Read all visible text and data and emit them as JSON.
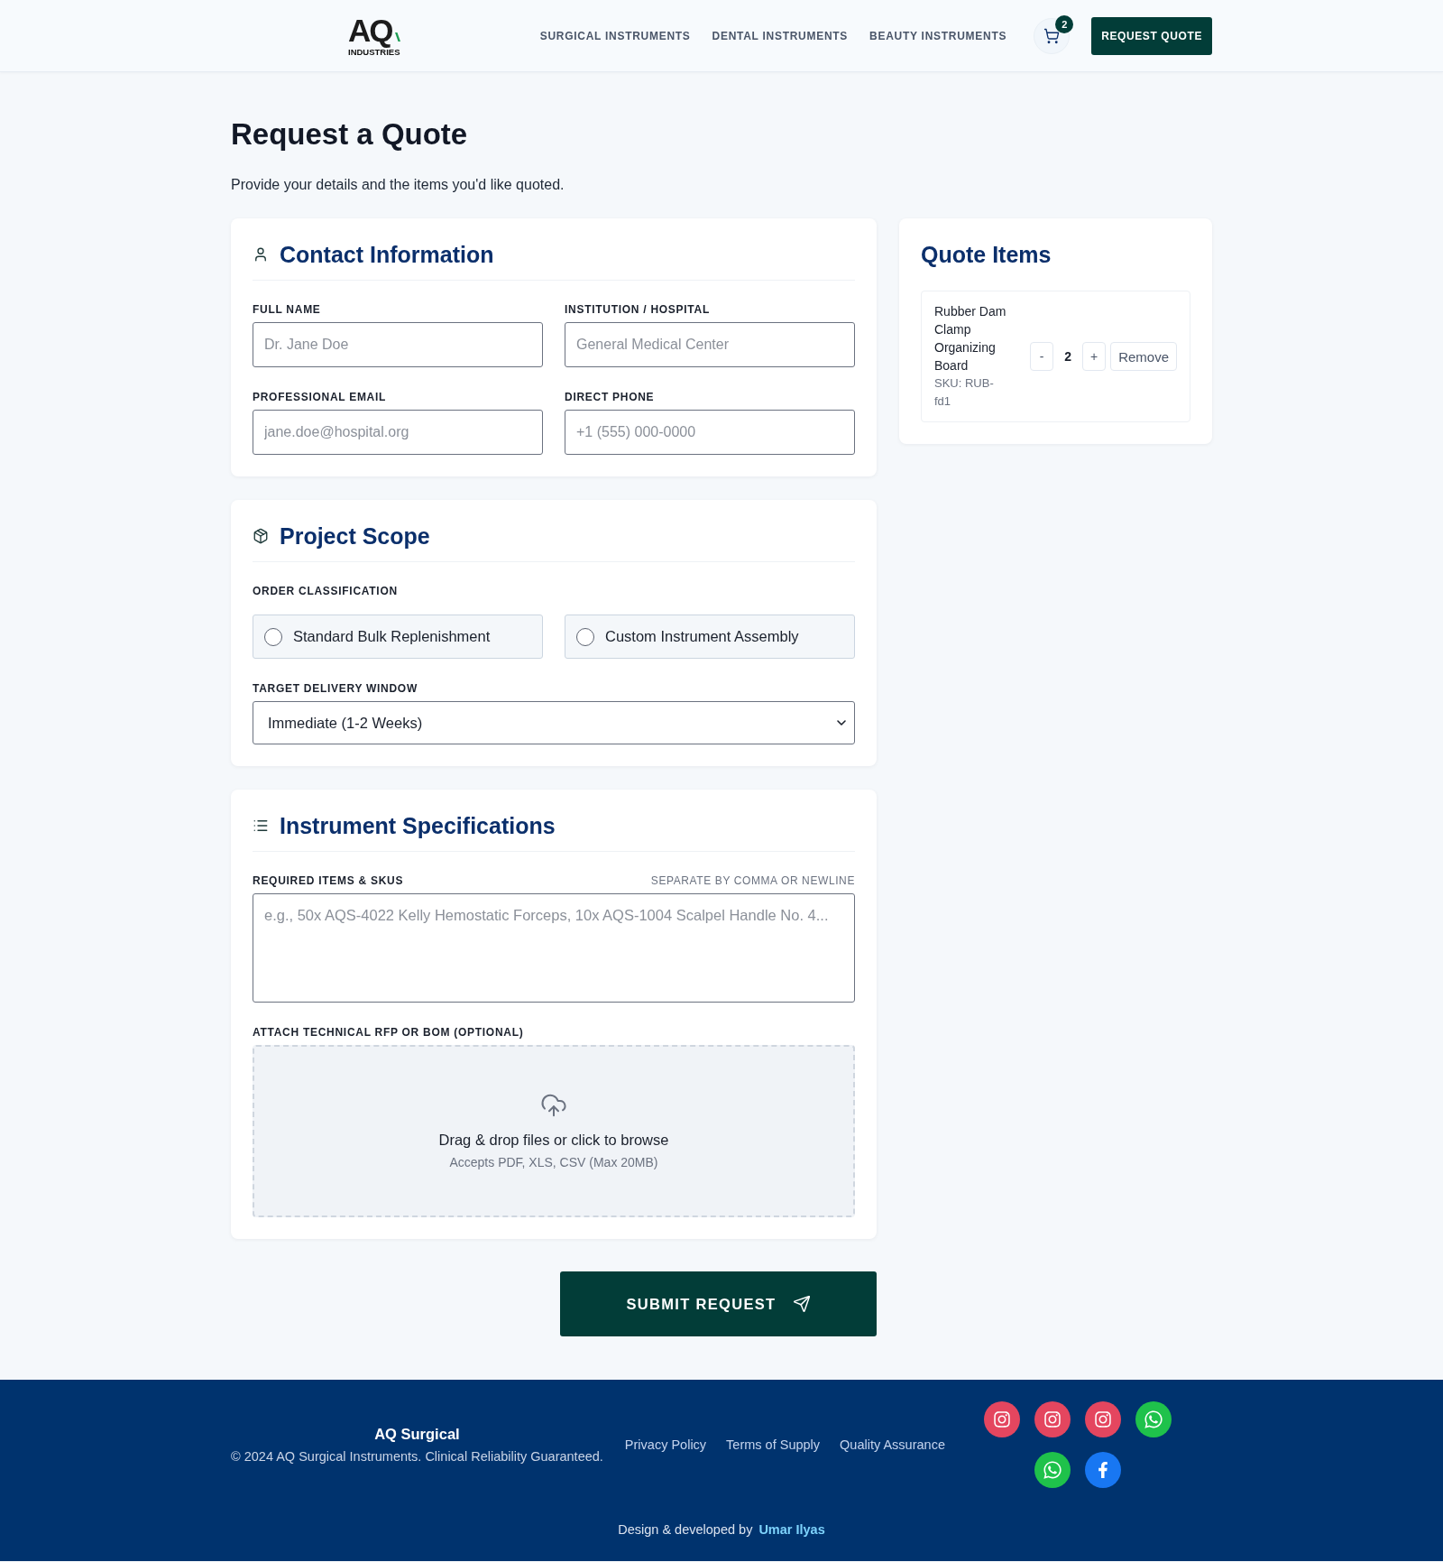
{
  "header": {
    "logo": {
      "mark": "AQ",
      "subtitle": "INDUSTRIES"
    },
    "nav": [
      "SURGICAL INSTRUMENTS",
      "DENTAL INSTRUMENTS",
      "BEAUTY INSTRUMENTS"
    ],
    "cart_count": "2",
    "cta": "REQUEST QUOTE"
  },
  "intro": {
    "title": "Request a Quote",
    "subtitle": "Provide your details and the items you'd like quoted."
  },
  "contact_information": {
    "title": "Contact Information",
    "fields": [
      {
        "label": "FULL NAME",
        "placeholder": "Dr. Jane Doe"
      },
      {
        "label": "INSTITUTION / HOSPITAL",
        "placeholder": "General Medical Center"
      },
      {
        "label": "PROFESSIONAL EMAIL",
        "placeholder": "jane.doe@hospital.org"
      },
      {
        "label": "DIRECT PHONE",
        "placeholder": "+1 (555) 000-0000"
      }
    ]
  },
  "project_scope": {
    "title": "Project Scope",
    "order_classification": {
      "label": "ORDER CLASSIFICATION",
      "options": [
        {
          "label": "Standard Bulk Replenishment",
          "selected": false
        },
        {
          "label": "Custom Instrument Assembly",
          "selected": false
        }
      ]
    },
    "delivery_window": {
      "label": "TARGET DELIVERY WINDOW",
      "value": "Immediate (1-2 Weeks)"
    }
  },
  "instrument_specifications": {
    "title": "Instrument Specifications",
    "required_items": {
      "label": "REQUIRED ITEMS & SKUS",
      "hint": "SEPARATE BY COMMA OR NEWLINE",
      "placeholder": "e.g., 50x AQS-4022 Kelly Hemostatic Forceps, 10x AQS-1004 Scalpel Handle No. 4..."
    },
    "attachment": {
      "label": "ATTACH TECHNICAL RFP OR BOM (OPTIONAL)",
      "prompt": "Drag & drop files or click to browse",
      "note": "Accepts PDF, XLS, CSV (Max 20MB)"
    }
  },
  "submit_button": "SUBMIT REQUEST",
  "quote_items": {
    "title": "Quote Items",
    "items": [
      {
        "name": "Rubber Dam Clamp Organizing Board",
        "sku": "SKU: RUB-fd1",
        "decrement": "-",
        "quantity": "2",
        "increment": "+",
        "remove": "Remove"
      }
    ]
  },
  "footer": {
    "brand": "AQ Surgical",
    "copyright": "© 2024 AQ Surgical Instruments. Clinical Reliability Guaranteed.",
    "links": [
      "Privacy Policy",
      "Terms of Supply",
      "Quality Assurance"
    ],
    "socials": [
      {
        "kind": "instagram"
      },
      {
        "kind": "instagram"
      },
      {
        "kind": "instagram"
      },
      {
        "kind": "whatsapp"
      },
      {
        "kind": "whatsapp"
      },
      {
        "kind": "facebook"
      }
    ],
    "credit": {
      "text": "Design & developed by",
      "author": "Umar Ilyas"
    }
  }
}
